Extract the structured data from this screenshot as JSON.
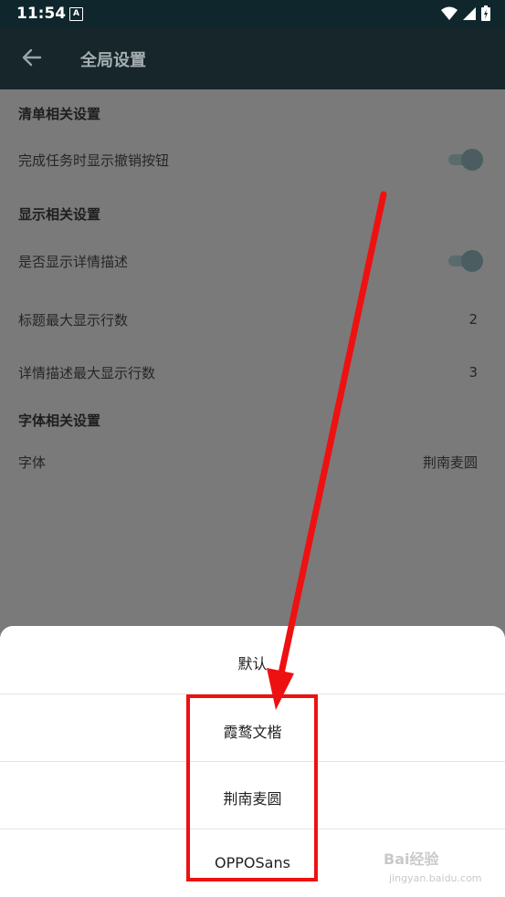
{
  "status_bar": {
    "time": "11:54",
    "sim_label": "A"
  },
  "app_bar": {
    "title": "全局设置"
  },
  "sections": {
    "list": {
      "title": "清单相关设置",
      "show_undo": {
        "label": "完成任务时显示撤销按钮",
        "enabled": true
      }
    },
    "display": {
      "title": "显示相关设置",
      "show_detail": {
        "label": "是否显示详情描述",
        "enabled": true
      },
      "title_max_lines": {
        "label": "标题最大显示行数",
        "value": "2"
      },
      "detail_max_lines": {
        "label": "详情描述最大显示行数",
        "value": "3"
      }
    },
    "font": {
      "title": "字体相关设置",
      "font": {
        "label": "字体",
        "value": "荆南麦圆"
      }
    }
  },
  "font_sheet": {
    "options": [
      "默认",
      "霞鹜文楷",
      "荆南麦圆",
      "OPPOSans"
    ]
  },
  "watermark": {
    "brand": "Bai经验",
    "url": "jingyan.baidu.com"
  },
  "colors": {
    "highlight": "#ee1111",
    "appbar": "#16262b"
  }
}
